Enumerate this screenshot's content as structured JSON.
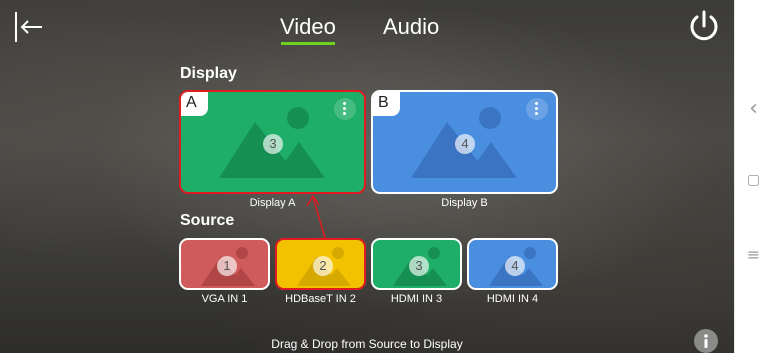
{
  "tabs": [
    {
      "label": "Video",
      "active": true
    },
    {
      "label": "Audio",
      "active": false
    }
  ],
  "accent_color": "#6fd11d",
  "selection_color": "#e01b22",
  "display_section": {
    "title": "Display"
  },
  "source_section": {
    "title": "Source"
  },
  "displays": [
    {
      "letter": "A",
      "number": "3",
      "label": "Display A",
      "color": "#1fae67",
      "selected": true
    },
    {
      "letter": "B",
      "number": "4",
      "label": "Display B",
      "color": "#4a8ee0",
      "selected": false
    }
  ],
  "sources": [
    {
      "number": "1",
      "label": "VGA IN 1",
      "color": "#cf5b5b",
      "selected": false
    },
    {
      "number": "2",
      "label": "HDBaseT IN 2",
      "color": "#f2c200",
      "selected": true
    },
    {
      "number": "3",
      "label": "HDMI IN 3",
      "color": "#1fae67",
      "selected": false
    },
    {
      "number": "4",
      "label": "HDMI IN 4",
      "color": "#4a8ee0",
      "selected": false
    }
  ],
  "hint": "Drag & Drop from Source to Display",
  "icons": {
    "back": "back-arrow-icon",
    "power": "power-icon",
    "info": "info-icon",
    "kebab": "more-vertical-icon"
  },
  "system_nav": {
    "back_glyph": "‹",
    "home_glyph": "▢",
    "recents_glyph": "≡"
  }
}
